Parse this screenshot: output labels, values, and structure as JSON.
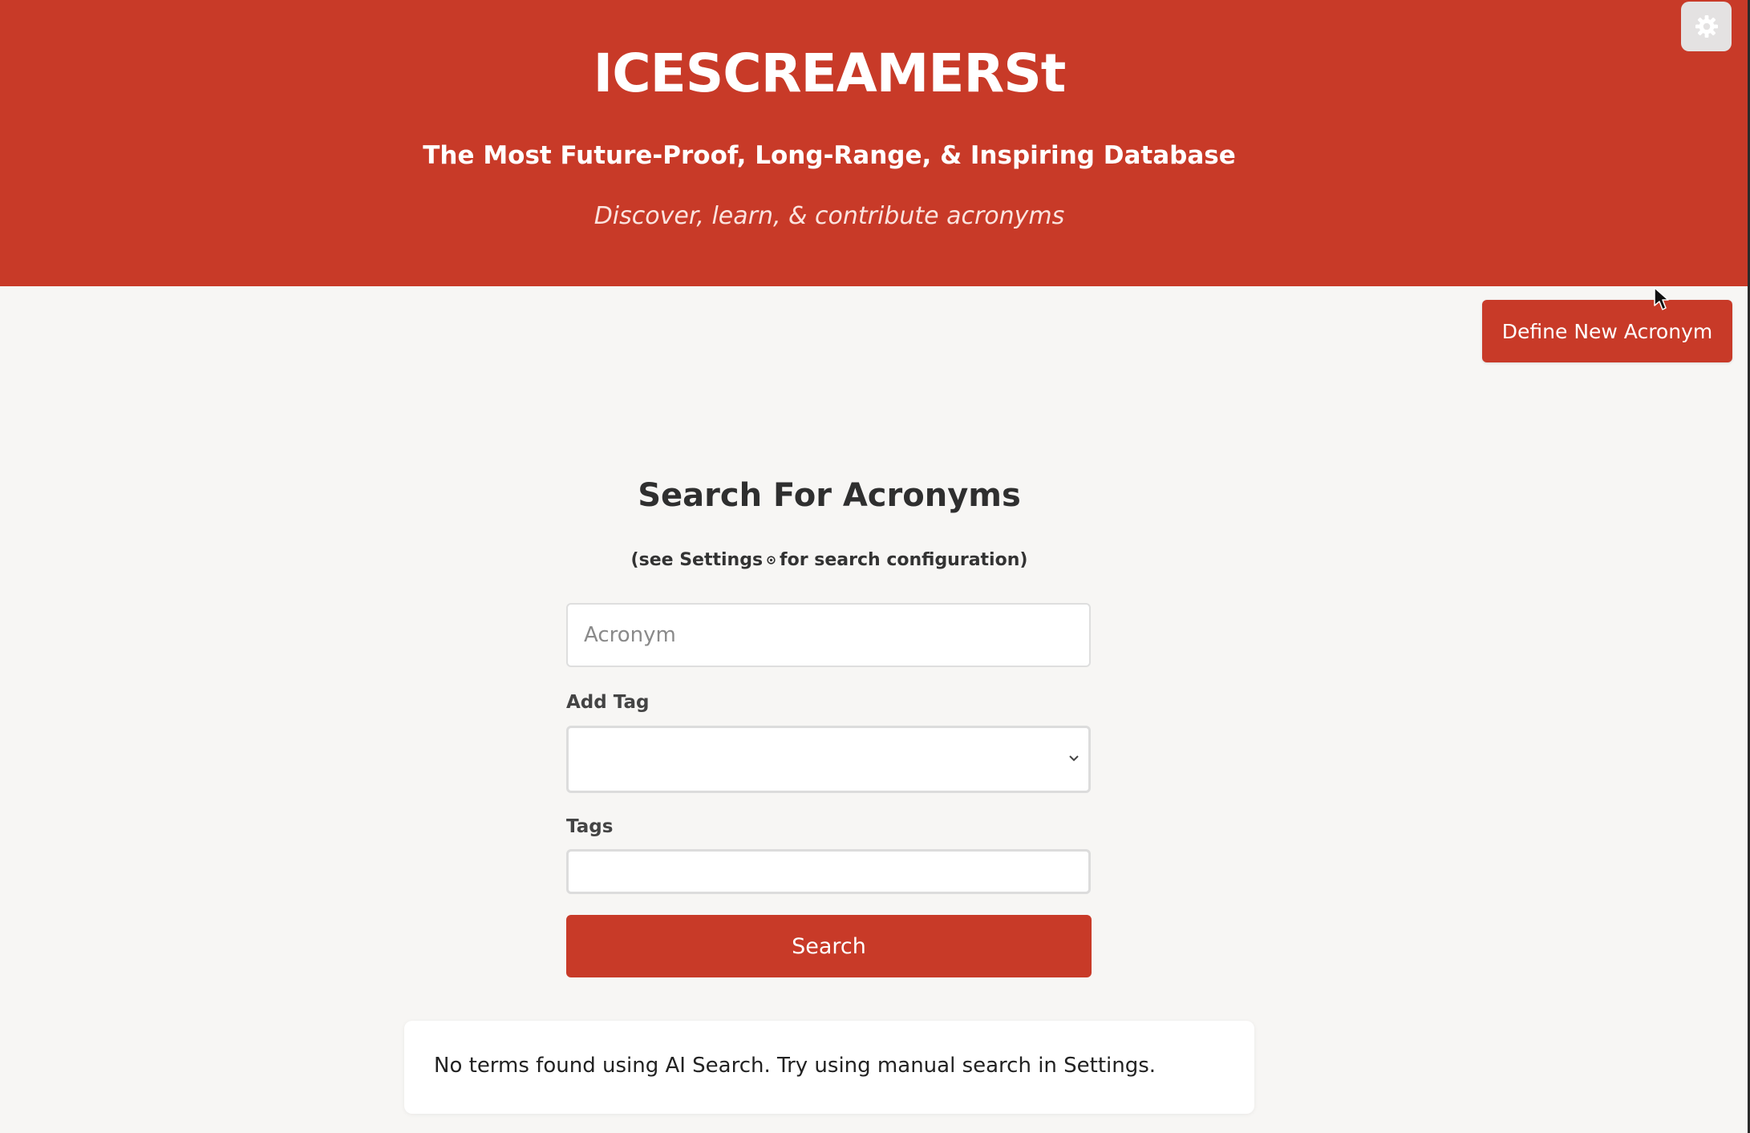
{
  "header": {
    "title": "ICESCREAMERSt",
    "subtitle": "The Most Future-Proof, Long-Range, & Inspiring Database",
    "tagline": "Discover, learn, & contribute acronyms",
    "settings_icon": "gear-icon"
  },
  "actions": {
    "define_label": "Define New Acronym"
  },
  "search": {
    "heading": "Search For Acronyms",
    "hint_prefix": "(see Settings",
    "hint_icon": "gear-icon",
    "hint_suffix": "for search configuration)",
    "acronym_placeholder": "Acronym",
    "add_tag_label": "Add Tag",
    "add_tag_value": "",
    "tags_label": "Tags",
    "button_label": "Search"
  },
  "results": {
    "message": "No terms found using AI Search. Try using manual search in Settings."
  },
  "colors": {
    "brand_red": "#c83a28",
    "page_background": "#f7f6f4",
    "text_dark": "#2f2f2f"
  }
}
